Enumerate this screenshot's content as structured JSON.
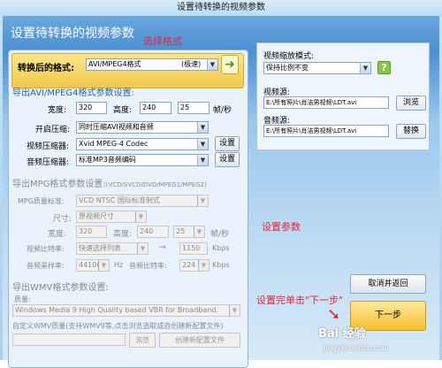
{
  "window": {
    "title": "设置待转换的视频参数"
  },
  "header": {
    "title": "设置待转换的视频参数"
  },
  "notes": {
    "choose_format": "选择格式",
    "set_params": "设置参数",
    "click_next": "设置完单击\"下一步\""
  },
  "format": {
    "label": "转换后的格式:",
    "value": "AVI/MPEG4格式",
    "badge": "(极速)"
  },
  "avi": {
    "section": "导出AVI/MPEG4格式参数设置:",
    "width_label": "宽度:",
    "width": "320",
    "height_label": "高度:",
    "height": "240",
    "fps": "25",
    "fps_unit": "帧/秒",
    "compressor_label": "开启压缩:",
    "compressor": "同时压缩AVI视频和音频",
    "video_codec_label": "视频压缩器:",
    "video_codec": "Xvid MPEG-4 Codec",
    "audio_codec_label": "音频压缩器:",
    "audio_codec": "标准MP3音频编码",
    "settings_label": "设置"
  },
  "mpg": {
    "section": "导出MPG格式参数设置:",
    "section_sub": "(VCD/SVCD/DVD/MPEG1/MPEG2)",
    "quality_label": "MPG质量标准:",
    "quality": "VCD  NTSC 国际标准制式",
    "size_label": "尺寸:",
    "size": "原视频尺寸",
    "width_label": "宽度:",
    "width": "320",
    "height_label": "高度:",
    "height": "240",
    "fps": "25",
    "fps_unit": "帧/秒",
    "bitrate_label": "视频比特率:",
    "bitrate_select": "快速选择列表",
    "bitrate": "1150",
    "bitrate_unit": "Kbps",
    "samplerate_label": "音频采样率:",
    "samplerate": "44100",
    "samplerate_unit": "Hz",
    "abitrate_label": "音频比特率:",
    "abitrate": "224",
    "abitrate_unit": "Kbps"
  },
  "wmv": {
    "section": "导出WMV格式参数设置:",
    "quality_label": "质量:",
    "quality": "Windows Media 9 High Quality based VBR for Broadband.",
    "custom_label": "自定义WMV质量(支持WMV9等,点击浏览选取或自创建新配置文件)",
    "browse": "浏览",
    "create": "创建新配置文件"
  },
  "scale": {
    "label": "视频缩放模式:",
    "value": "保持比例不变"
  },
  "source": {
    "label": "视频源:",
    "value": "E:\\所有照片\\肖洁男视频\\LDT.avi",
    "browse": "浏览"
  },
  "audio_source": {
    "label": "音频源:",
    "value": "E:\\所有照片\\肖洁男视频\\LDT.avi",
    "replace": "替换"
  },
  "buttons": {
    "cancel": "取消并返回",
    "next": "下一步"
  },
  "watermark": {
    "brand": "Bai 经验",
    "url": "jingyan.baidu.com"
  }
}
